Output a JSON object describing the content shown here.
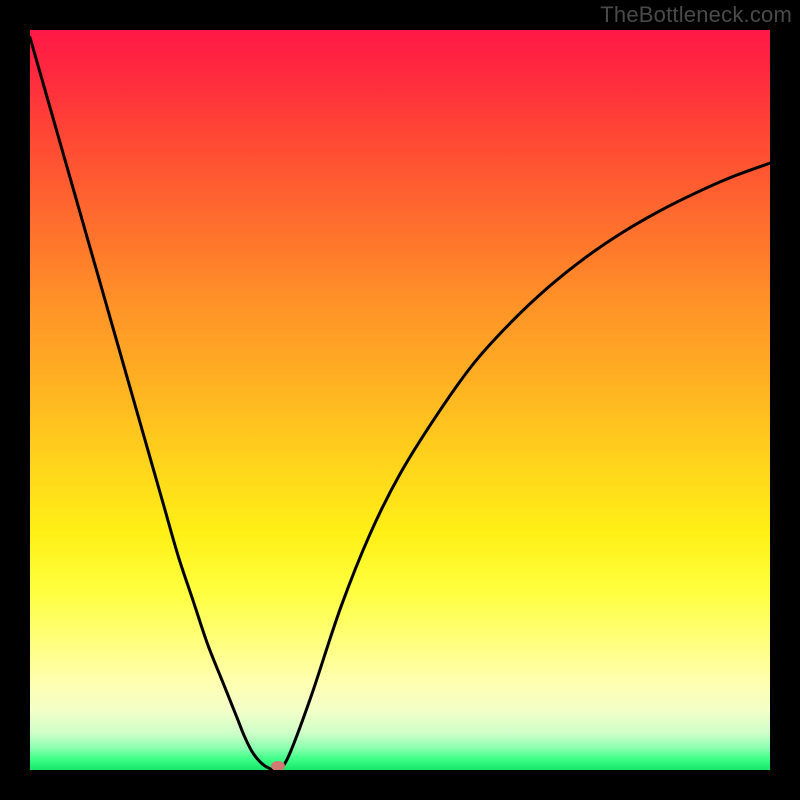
{
  "watermark": "TheBottleneck.com",
  "chart_data": {
    "type": "line",
    "title": "",
    "xlabel": "",
    "ylabel": "",
    "xlim": [
      0,
      100
    ],
    "ylim": [
      0,
      100
    ],
    "grid": false,
    "legend": false,
    "series": [
      {
        "name": "curve",
        "x": [
          0,
          2,
          4,
          6,
          8,
          10,
          12,
          14,
          16,
          18,
          20,
          22,
          24,
          26,
          28,
          29,
          30,
          31,
          32,
          33.5,
          35,
          38,
          42,
          46,
          50,
          55,
          60,
          65,
          70,
          75,
          80,
          85,
          90,
          95,
          100
        ],
        "y": [
          99,
          92,
          85,
          78,
          71,
          64,
          57,
          50,
          43,
          36,
          29,
          23,
          17,
          12,
          7,
          4.5,
          2.5,
          1.2,
          0.4,
          0,
          2,
          10,
          22,
          32,
          40,
          48,
          55,
          60.5,
          65.2,
          69.2,
          72.6,
          75.5,
          78,
          80.2,
          82
        ]
      }
    ],
    "marker": {
      "x": 33.5,
      "y": 0.5
    }
  }
}
